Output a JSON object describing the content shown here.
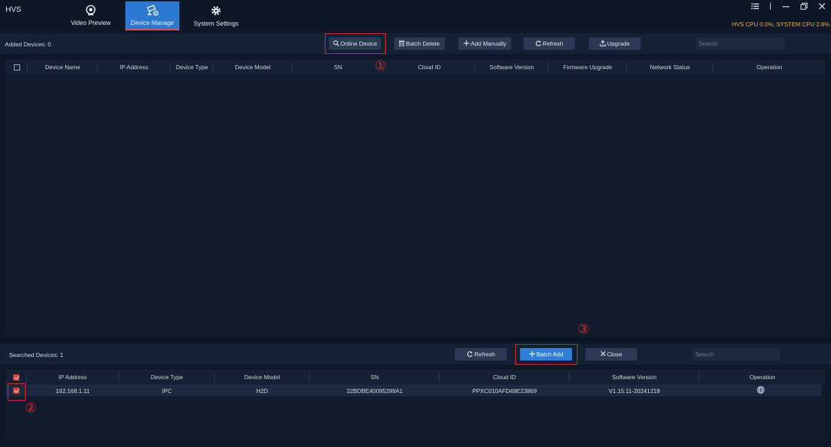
{
  "app": {
    "title": "HVS"
  },
  "nav": [
    {
      "label": "Video Preview",
      "icon": "camera-icon"
    },
    {
      "label": "Device Manage",
      "icon": "device-manage-icon",
      "active": true
    },
    {
      "label": "System Settings",
      "icon": "gear-icon"
    }
  ],
  "window": {
    "status": "HVS CPU 0.0%, SYSTEM CPU 2.6%"
  },
  "colors": {
    "background": "#0f1827",
    "accent": "#2c79d2",
    "highlight": "#e0282c",
    "status": "#f0b43a"
  },
  "added": {
    "count_label": "Added Devices: 0",
    "buttons": {
      "online_device": "Online Device",
      "batch_delete": "Batch Delete",
      "add_manually": "Add Manually",
      "refresh": "Refresh",
      "upgrade": "Upgrade"
    },
    "search_placeholder": "Search",
    "columns": [
      "Device Name",
      "IP Address",
      "Device Type",
      "Device Model",
      "SN",
      "Cloud ID",
      "Software Version",
      "Firmware Upgrade",
      "Network Status",
      "Operation"
    ],
    "rows": []
  },
  "searched": {
    "count_label": "Searched Devices: 1",
    "buttons": {
      "refresh": "Refresh",
      "batch_add": "Batch Add",
      "close": "Close"
    },
    "search_placeholder": "Search",
    "columns": [
      "IP Address",
      "Device Type",
      "Device Model",
      "SN",
      "Cloud ID",
      "Software Version",
      "Operation"
    ],
    "rows": [
      {
        "checked": true,
        "ip": "192.168.1.11",
        "type": "IPC",
        "model": "H2D",
        "sn": "22BDBE40095299A1",
        "cloud_id": "PPXC010AFD49E23869",
        "software_version": "V1.15.11-20241218",
        "operation_icon": "globe-icon"
      }
    ]
  },
  "annotations": [
    "①",
    "②",
    "③"
  ]
}
